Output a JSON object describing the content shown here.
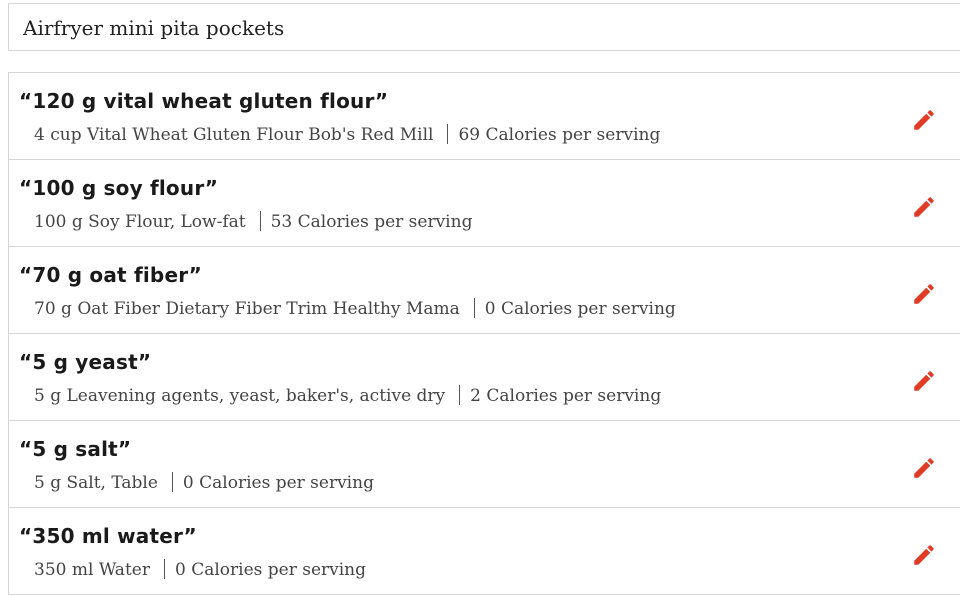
{
  "recipe": {
    "title": "Airfryer mini pita pockets"
  },
  "ingredients": [
    {
      "quote": "“120 g vital wheat gluten flour”",
      "food": "4 cup Vital Wheat Gluten Flour Bob's Red Mill",
      "calories": "69 Calories per serving"
    },
    {
      "quote": "“100 g soy flour”",
      "food": "100 g Soy Flour, Low-fat",
      "calories": "53 Calories per serving"
    },
    {
      "quote": "“70 g oat fiber”",
      "food": "70 g Oat Fiber Dietary Fiber Trim Healthy Mama",
      "calories": "0 Calories per serving"
    },
    {
      "quote": "“5 g yeast”",
      "food": "5 g Leavening agents, yeast, baker's, active dry",
      "calories": "2 Calories per serving"
    },
    {
      "quote": "“5 g salt”",
      "food": "5 g Salt, Table",
      "calories": "0 Calories per serving"
    },
    {
      "quote": "“350 ml water”",
      "food": "350 ml Water",
      "calories": "0 Calories per serving"
    }
  ],
  "icons": {
    "edit": "pencil-icon",
    "accent_color": "#e03b24"
  }
}
